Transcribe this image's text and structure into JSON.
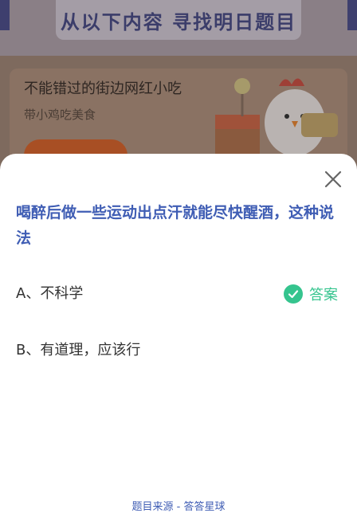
{
  "background": {
    "banner_text": "从以下内容  寻找明日题目",
    "card": {
      "title": "不能错过的街边网红小吃",
      "subtitle": "带小鸡吃美食"
    }
  },
  "modal": {
    "question": "喝醉后做一些运动出点汗就能尽快醒酒，这种说法",
    "options": [
      {
        "label": "A、不科学",
        "is_answer": true
      },
      {
        "label": "B、有道理，应该行",
        "is_answer": false
      }
    ],
    "answer_label": "答案",
    "source": "题目来源 - 答答星球"
  },
  "colors": {
    "question": "#3f5db4",
    "answer": "#35c48e"
  }
}
